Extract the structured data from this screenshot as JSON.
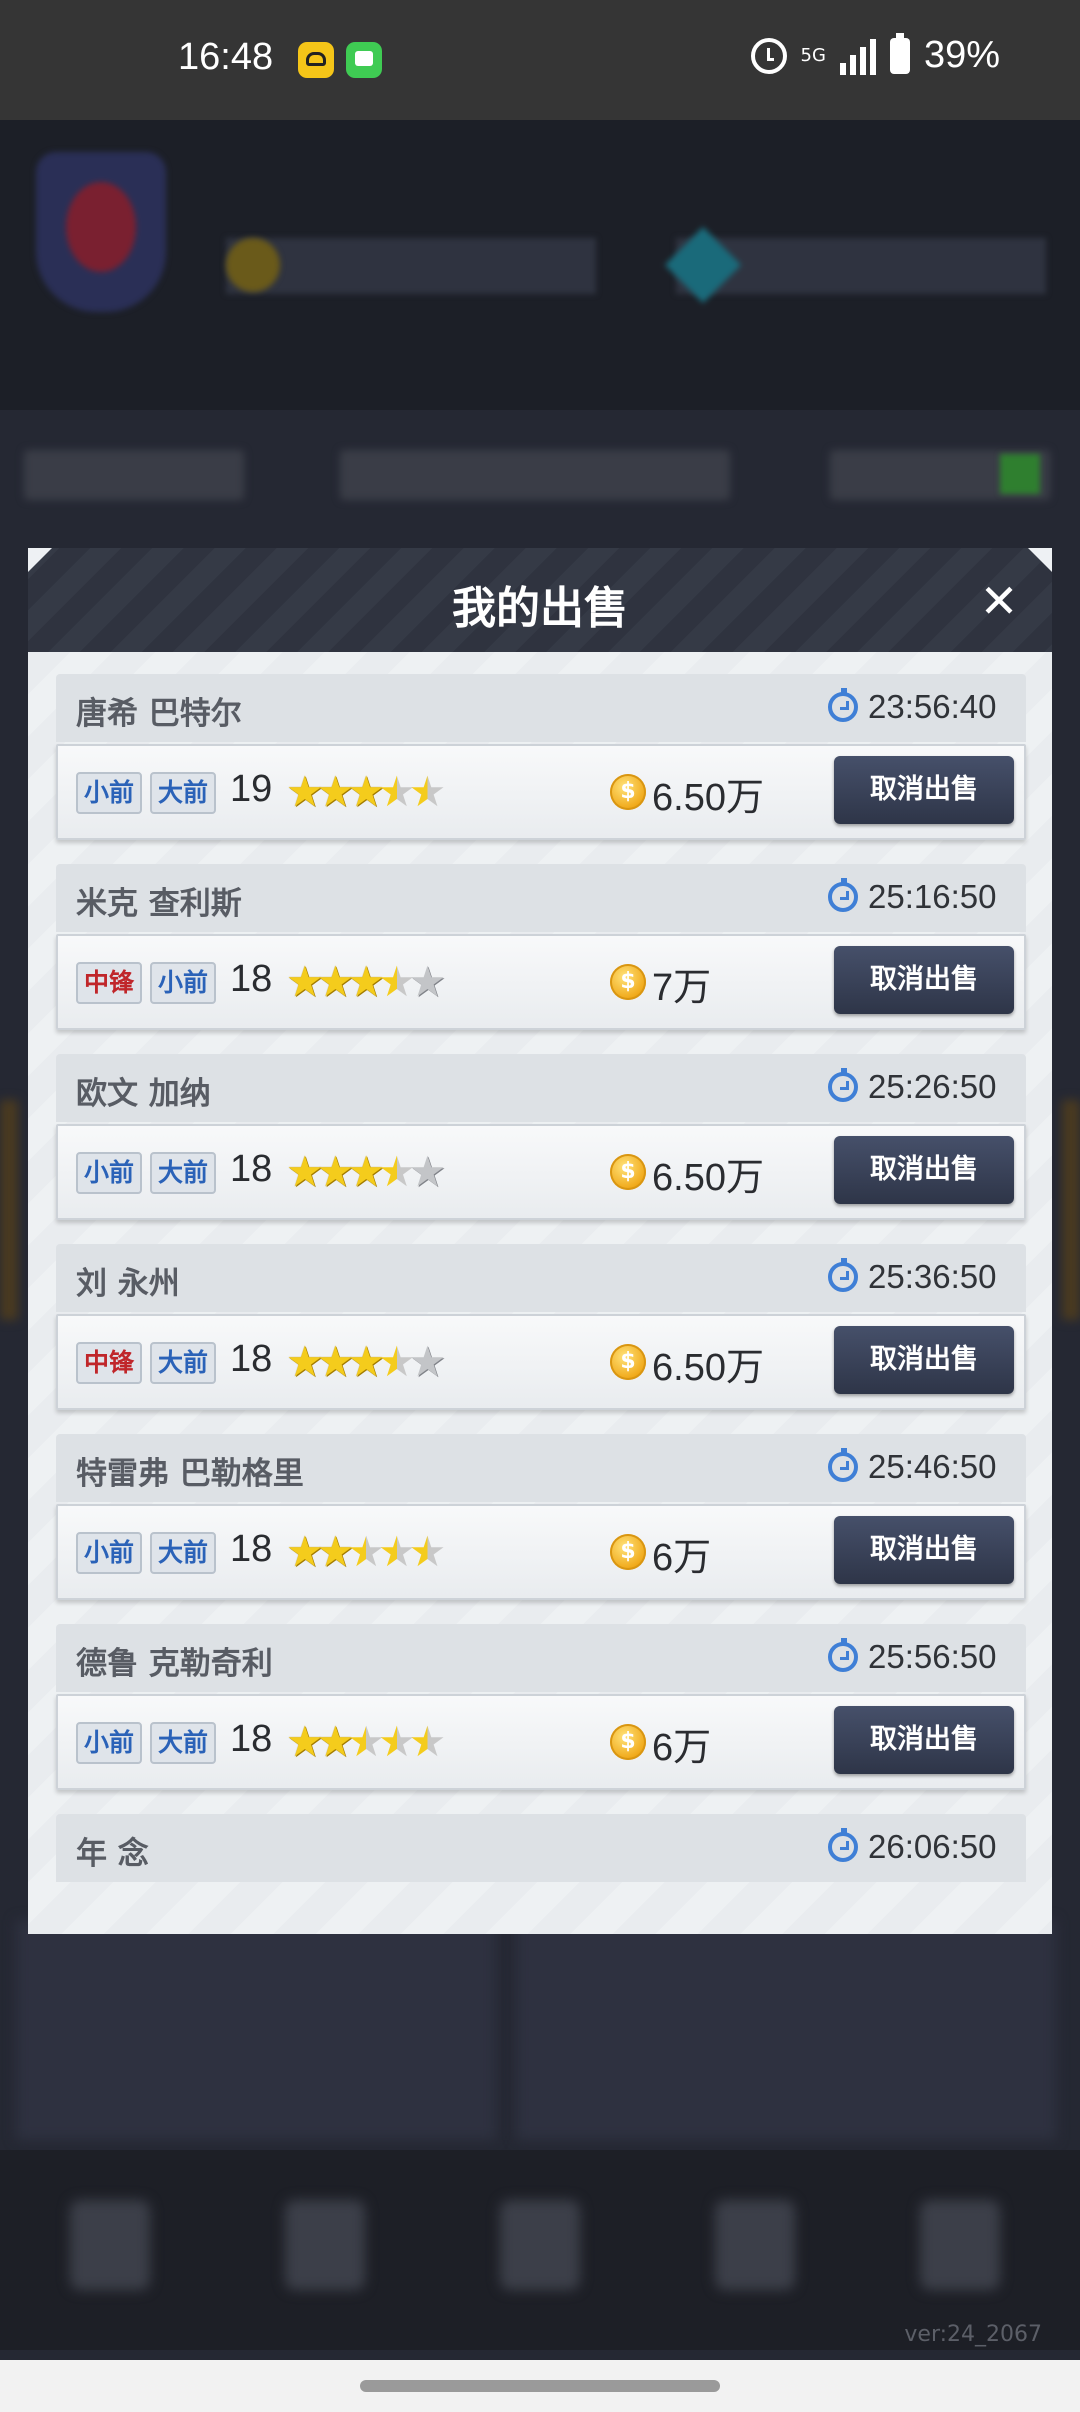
{
  "status_bar": {
    "time": "16:48",
    "network": "5G",
    "battery": "39%"
  },
  "modal": {
    "title": "我的出售",
    "close": "✕"
  },
  "listings": [
    {
      "name": "唐希 巴特尔",
      "time": "23:56:40",
      "positions": [
        {
          "label": "小前",
          "color": "blue"
        },
        {
          "label": "大前",
          "color": "blue"
        }
      ],
      "level": "19",
      "stars": [
        1,
        1,
        1,
        0.5,
        0.5
      ],
      "price": "6.50万",
      "cancel": "取消出售"
    },
    {
      "name": "米克 查利斯",
      "time": "25:16:50",
      "positions": [
        {
          "label": "中锋",
          "color": "red"
        },
        {
          "label": "小前",
          "color": "blue"
        }
      ],
      "level": "18",
      "stars": [
        1,
        1,
        1,
        0.5,
        0
      ],
      "price": "7万",
      "cancel": "取消出售"
    },
    {
      "name": "欧文 加纳",
      "time": "25:26:50",
      "positions": [
        {
          "label": "小前",
          "color": "blue"
        },
        {
          "label": "大前",
          "color": "blue"
        }
      ],
      "level": "18",
      "stars": [
        1,
        1,
        1,
        0.5,
        0
      ],
      "price": "6.50万",
      "cancel": "取消出售"
    },
    {
      "name": "刘 永州",
      "time": "25:36:50",
      "positions": [
        {
          "label": "中锋",
          "color": "red"
        },
        {
          "label": "大前",
          "color": "blue"
        }
      ],
      "level": "18",
      "stars": [
        1,
        1,
        1,
        0.5,
        0
      ],
      "price": "6.50万",
      "cancel": "取消出售"
    },
    {
      "name": "特雷弗 巴勒格里",
      "time": "25:46:50",
      "positions": [
        {
          "label": "小前",
          "color": "blue"
        },
        {
          "label": "大前",
          "color": "blue"
        }
      ],
      "level": "18",
      "stars": [
        1,
        1,
        0.5,
        0.5,
        0.5
      ],
      "price": "6万",
      "cancel": "取消出售"
    },
    {
      "name": "德鲁 克勒奇利",
      "time": "25:56:50",
      "positions": [
        {
          "label": "小前",
          "color": "blue"
        },
        {
          "label": "大前",
          "color": "blue"
        }
      ],
      "level": "18",
      "stars": [
        1,
        1,
        0.5,
        0.5,
        0.5
      ],
      "price": "6万",
      "cancel": "取消出售"
    },
    {
      "name": "年 念",
      "time": "26:06:50"
    }
  ],
  "version": "ver:24_2067",
  "colors": {
    "header_bg": "#353a46",
    "button_bg": "#2e3548",
    "timer_blue": "#3f7fd6",
    "star_gold": "#f4cc1c",
    "pos_blue": "#2a62b8",
    "pos_red": "#c0262a"
  }
}
